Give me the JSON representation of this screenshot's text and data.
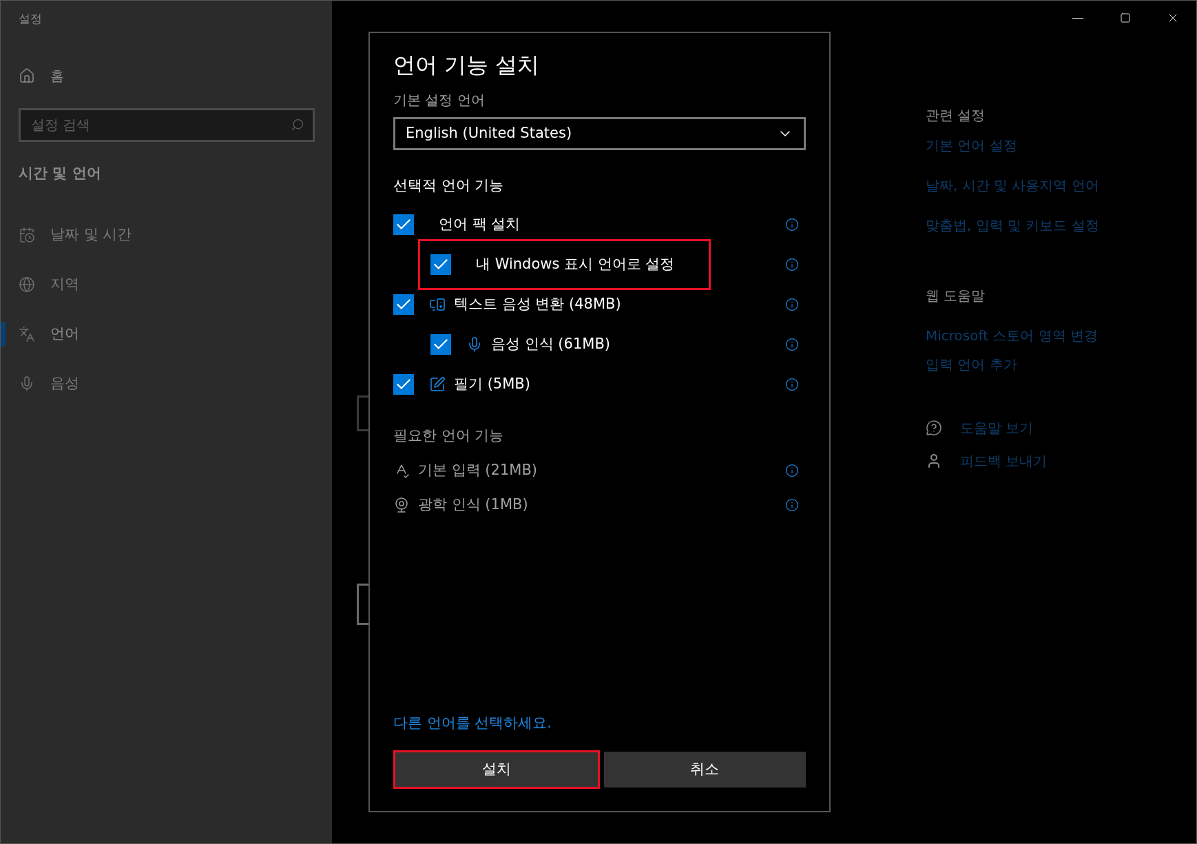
{
  "window": {
    "title": "설정"
  },
  "sidebar": {
    "home": "홈",
    "search": {
      "placeholder": "설정 검색"
    },
    "section": "시간 및 언어",
    "items": [
      {
        "label": "날짜 및 시간",
        "selected": false
      },
      {
        "label": "지역",
        "selected": false
      },
      {
        "label": "언어",
        "selected": true
      },
      {
        "label": "음성",
        "selected": false
      }
    ]
  },
  "dialog": {
    "title": "언어 기능 설치",
    "preferred_label": "기본 설정 언어",
    "preferred_value": "English (United States)",
    "optional_heading": "선택적 언어 기능",
    "optional_features": [
      {
        "label": "언어 팩 설치",
        "checked": true,
        "highlighted": false,
        "children": [
          {
            "label": "내 Windows 표시 언어로 설정",
            "checked": true,
            "highlighted": true
          }
        ]
      },
      {
        "label": "텍스트 음성 변환 (48MB)",
        "checked": true,
        "highlighted": false,
        "children": [
          {
            "label": "음성 인식 (61MB)",
            "checked": true,
            "highlighted": false
          }
        ]
      },
      {
        "label": "필기 (5MB)",
        "checked": true,
        "highlighted": false
      }
    ],
    "required_heading": "필요한 언어 기능",
    "required_features": [
      "기본 입력 (21MB)",
      "광학 인식 (1MB)"
    ],
    "link": "다른 언어를 선택하세요.",
    "buttons": [
      {
        "label": "설치",
        "highlighted": true
      },
      {
        "label": "취소",
        "highlighted": false
      }
    ]
  },
  "related": {
    "heading": "관련 설정",
    "links": [
      "기본 언어 설정",
      "날짜, 시간 및 사용지역 언어",
      "맞춤법, 입력 및 키보드 설정"
    ]
  },
  "web_help": {
    "heading": "웹 도움말",
    "links": [
      "Microsoft 스토어 영역 변경",
      "입력 언어 추가"
    ]
  },
  "support": [
    "도움말 보기",
    "피드백 보내기"
  ]
}
